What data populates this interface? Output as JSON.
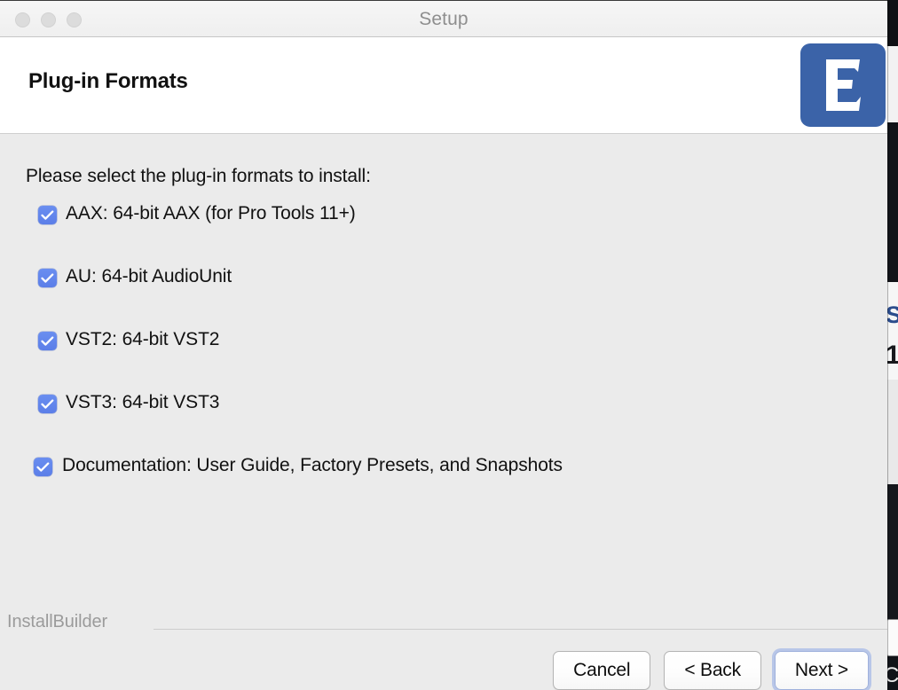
{
  "window": {
    "title": "Setup",
    "traffic_lights": [
      "close-button",
      "minimize-button",
      "zoom-button"
    ]
  },
  "header": {
    "title": "Plug-in Formats",
    "logo_letter": "E",
    "logo_color": "#3b63a8"
  },
  "content": {
    "prompt": "Please select the plug-in formats to install:",
    "options": [
      {
        "label": "AAX: 64-bit AAX (for Pro Tools 11+)",
        "checked": true,
        "name": "checkbox-aax"
      },
      {
        "label": "AU: 64-bit AudioUnit",
        "checked": true,
        "name": "checkbox-au"
      },
      {
        "label": "VST2: 64-bit VST2",
        "checked": true,
        "name": "checkbox-vst2"
      },
      {
        "label": "VST3: 64-bit VST3",
        "checked": true,
        "name": "checkbox-vst3"
      },
      {
        "label": "Documentation: User Guide, Factory Presets, and Snapshots",
        "checked": true,
        "name": "checkbox-documentation"
      }
    ],
    "checkbox_color": "#5b7ee8"
  },
  "footer": {
    "brand": "InstallBuilder",
    "buttons": {
      "cancel": "Cancel",
      "back": "< Back",
      "next": "Next >"
    },
    "default_button": "next",
    "focus_ring_color": "#b8c6e8"
  },
  "background": {
    "fragment_s": "S",
    "fragment_1": "1",
    "fragment_c": "C"
  }
}
